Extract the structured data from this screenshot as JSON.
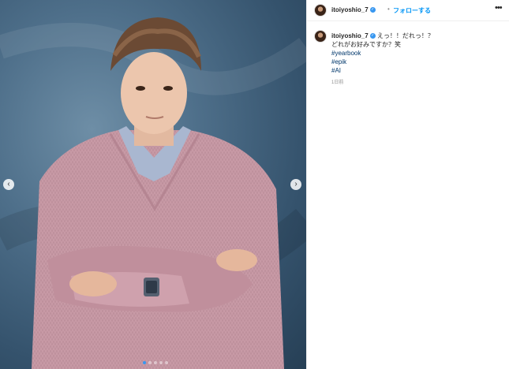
{
  "header": {
    "username": "itoiyoshio_7",
    "verified_icon": "verified-badge-icon",
    "separator": "•",
    "follow_label": "フォローする",
    "more_label": "•••"
  },
  "caption": {
    "username": "itoiyoshio_7",
    "line1": "えっ！！だれっ！？",
    "line2": "どれがお好みですか？笑",
    "hashtags": [
      "#yearbook",
      "#epik",
      "#AI"
    ],
    "time": "1日前"
  },
  "media": {
    "prev_icon": "chevron-left-icon",
    "next_icon": "chevron-right-icon",
    "prev_glyph": "‹",
    "next_glyph": "›",
    "slide_count": 5,
    "active_slide": 1
  },
  "colors": {
    "accent": "#0095f6",
    "hashtag": "#00376b",
    "sweater": "#c89aa6",
    "backdrop": "#4e6f8a"
  }
}
